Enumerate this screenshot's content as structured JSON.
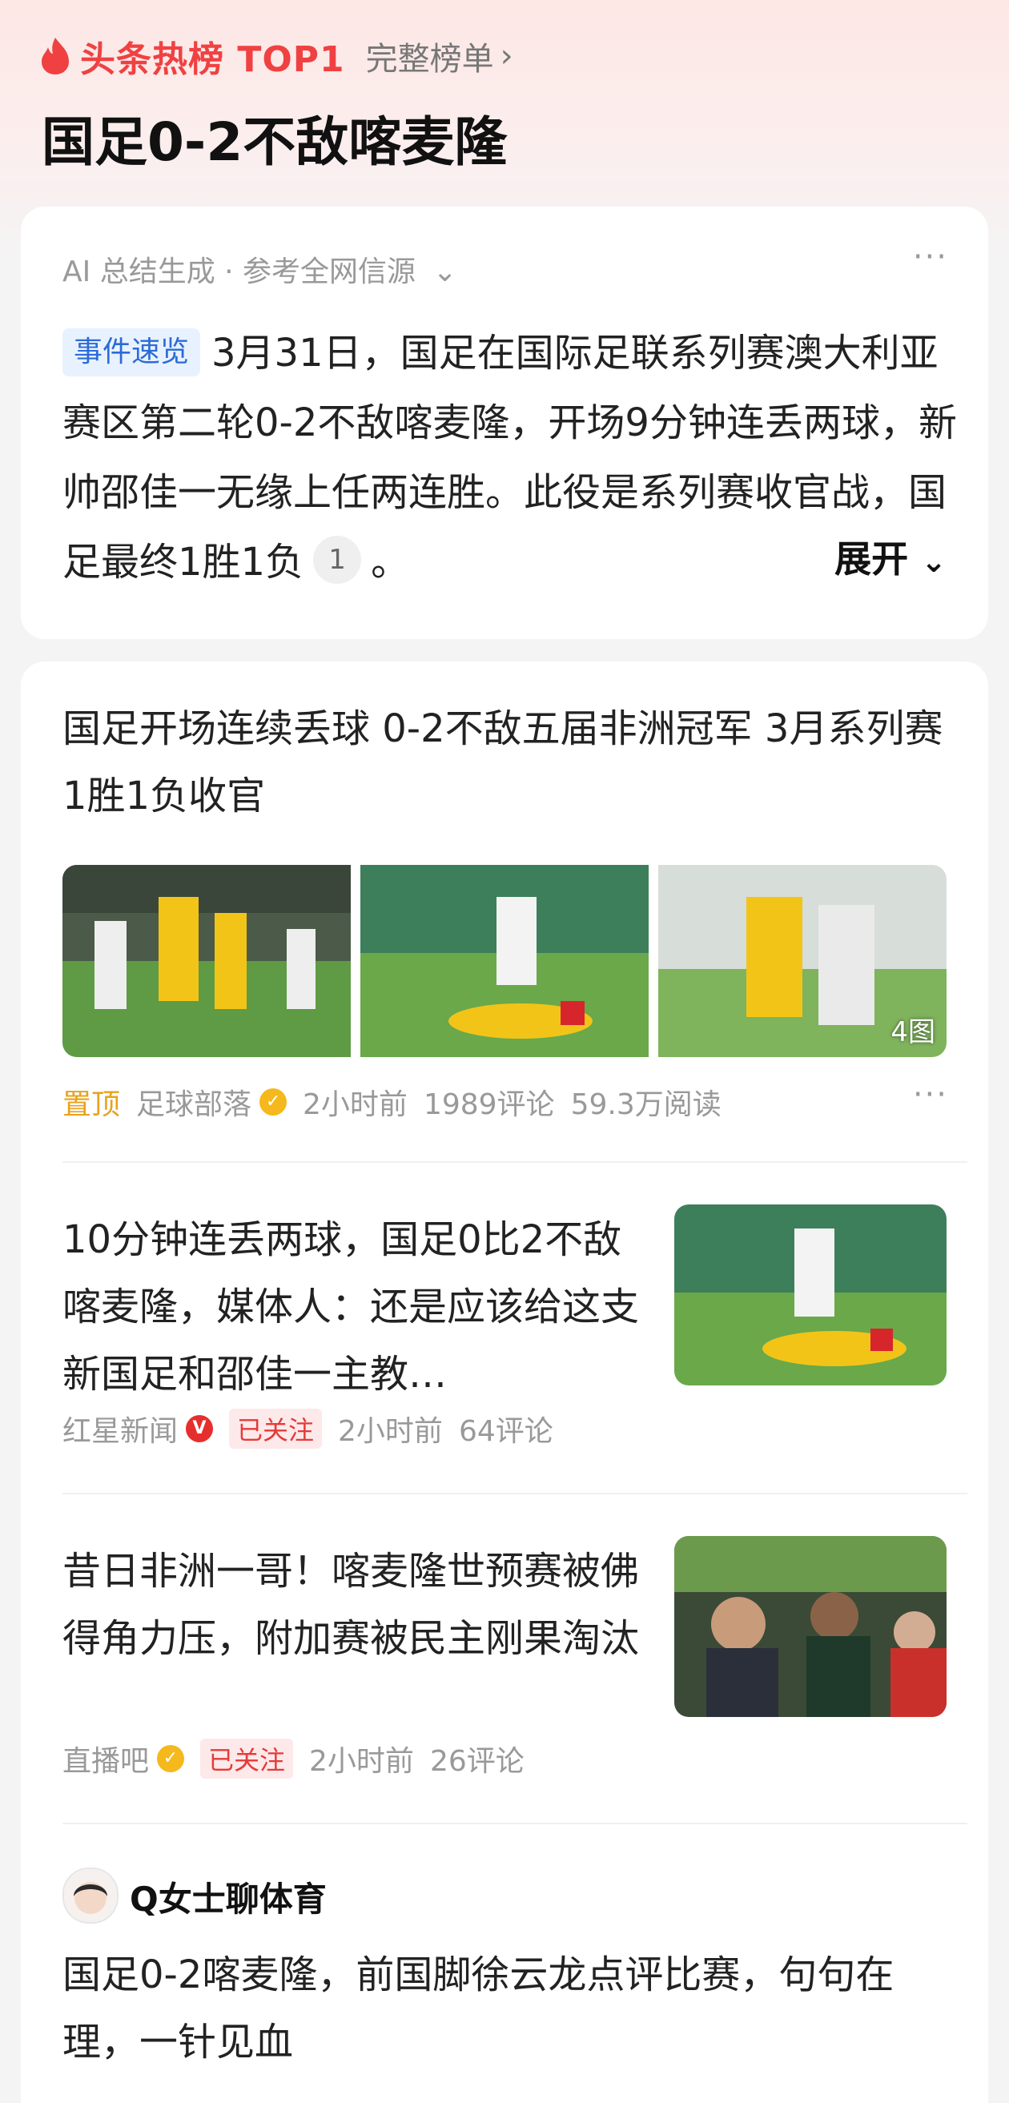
{
  "header": {
    "hot_label": "头条热榜 TOP1",
    "full_list": "完整榜单",
    "headline": "国足0-2不敌喀麦隆"
  },
  "summary": {
    "source": "AI 总结生成 · 参考全网信源",
    "tag": "事件速览",
    "text_before_cite": "3月31日，国足在国际足联系列赛澳大利亚赛区第二轮0-2不敌喀麦隆，开场9分钟连丢两球，新帅邵佳一无缘上任两连胜。此役是系列赛收官战，国足最终1胜1负",
    "cite_number": "1",
    "text_after_cite": "。",
    "expand": "展开"
  },
  "news": [
    {
      "title": "国足开场连续丢球 0-2不敌五届非洲冠军 3月系列赛1胜1负收官",
      "pinned": "置顶",
      "source": "足球部落",
      "time": "2小时前",
      "comments": "1989评论",
      "reads": "59.3万阅读",
      "image_count": "4图"
    },
    {
      "title": "10分钟连丢两球，国足0比2不敌喀麦隆，媒体人：还是应该给这支新国足和邵佳一主教…",
      "source": "红星新闻",
      "followed": "已关注",
      "time": "2小时前",
      "comments": "64评论"
    },
    {
      "title": "昔日非洲一哥！喀麦隆世预赛被佛得角力压，附加赛被民主刚果淘汰",
      "source": "直播吧",
      "followed": "已关注",
      "time": "2小时前",
      "comments": "26评论"
    },
    {
      "author": "Q女士聊体育",
      "title": "国足0-2喀麦隆，前国脚徐云龙点评比赛，句句在理，一针见血"
    }
  ],
  "icons": {
    "more": "more-dots-icon",
    "verified": "verified-v-badge",
    "flame": "flame-icon"
  },
  "colors": {
    "hot_red": "#f04142",
    "pinned_orange": "#e8a21d",
    "tag_blue": "#2b6bd8",
    "followed_red": "#e53a3a"
  }
}
